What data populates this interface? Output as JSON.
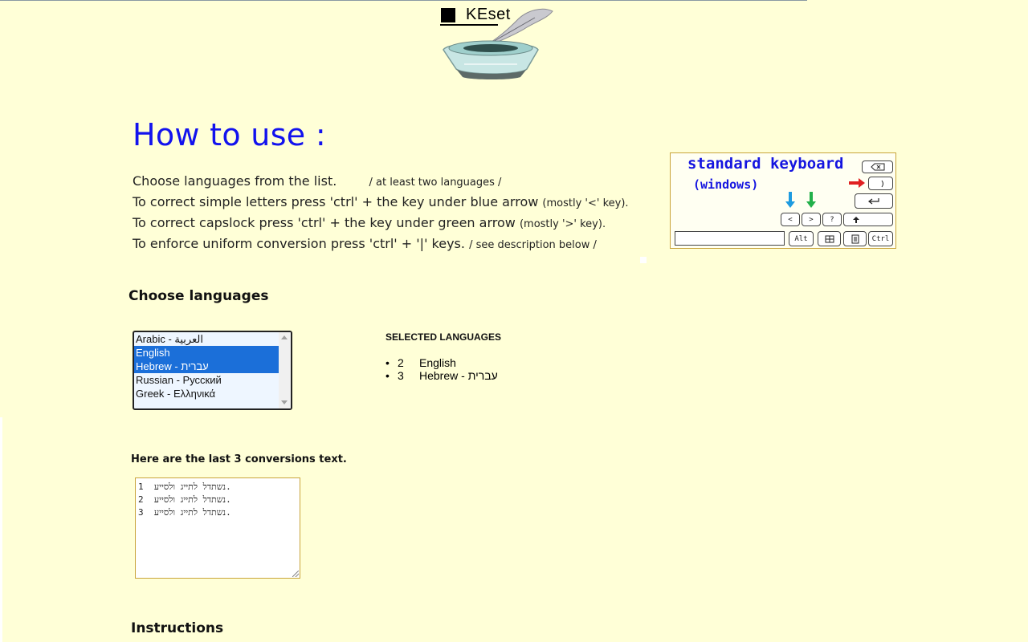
{
  "logo": {
    "text": "KEset"
  },
  "title": "How to use :",
  "instructions": [
    {
      "main": "Choose languages from the list.",
      "note": "/ at least two languages /"
    },
    {
      "main": "To correct simple letters press 'ctrl' + the key under blue arrow",
      "note": "(mostly '<' key)."
    },
    {
      "main": "To correct capslock press 'ctrl' + the key under green arrow",
      "note": "(mostly '>' key)."
    },
    {
      "main": "To enforce uniform conversion press 'ctrl' + '|' keys.",
      "note": "/ see description below /"
    }
  ],
  "keyboard": {
    "title": "standard keyboard",
    "subtitle": "(windows)",
    "keys": {
      "alt": "Alt",
      "ctrl": "Ctrl",
      "lt": "<",
      "gt": ">",
      "q": "?"
    },
    "arrow_colors": {
      "blue": "#1e9be0",
      "green": "#22b04a",
      "red": "#e02020"
    }
  },
  "choose_languages": {
    "heading": "Choose languages",
    "options": [
      {
        "label": "Arabic - العربية",
        "selected": false
      },
      {
        "label": "English",
        "selected": true
      },
      {
        "label": "Hebrew - עברית",
        "selected": true
      },
      {
        "label": "Russian - Русский",
        "selected": false
      },
      {
        "label": "Greek - Ελληνικά",
        "selected": false
      }
    ]
  },
  "selected_languages": {
    "heading": "SELECTED LANGUAGES",
    "items": [
      {
        "num": "2",
        "name": "English"
      },
      {
        "num": "3",
        "name": "Hebrew - עברית"
      }
    ]
  },
  "conversions": {
    "label": "Here are the last 3 conversions text.",
    "lines": [
      "1  נשתדל לתייג ולסייע.",
      "2  נשתדל לתייג ולסייע.",
      "3  נשתדל לתייג ולסייע."
    ]
  },
  "instructions_heading": "Instructions",
  "colors": {
    "background": "#ffffd7",
    "title": "#1212ee",
    "selection": "#1b6fd9"
  }
}
